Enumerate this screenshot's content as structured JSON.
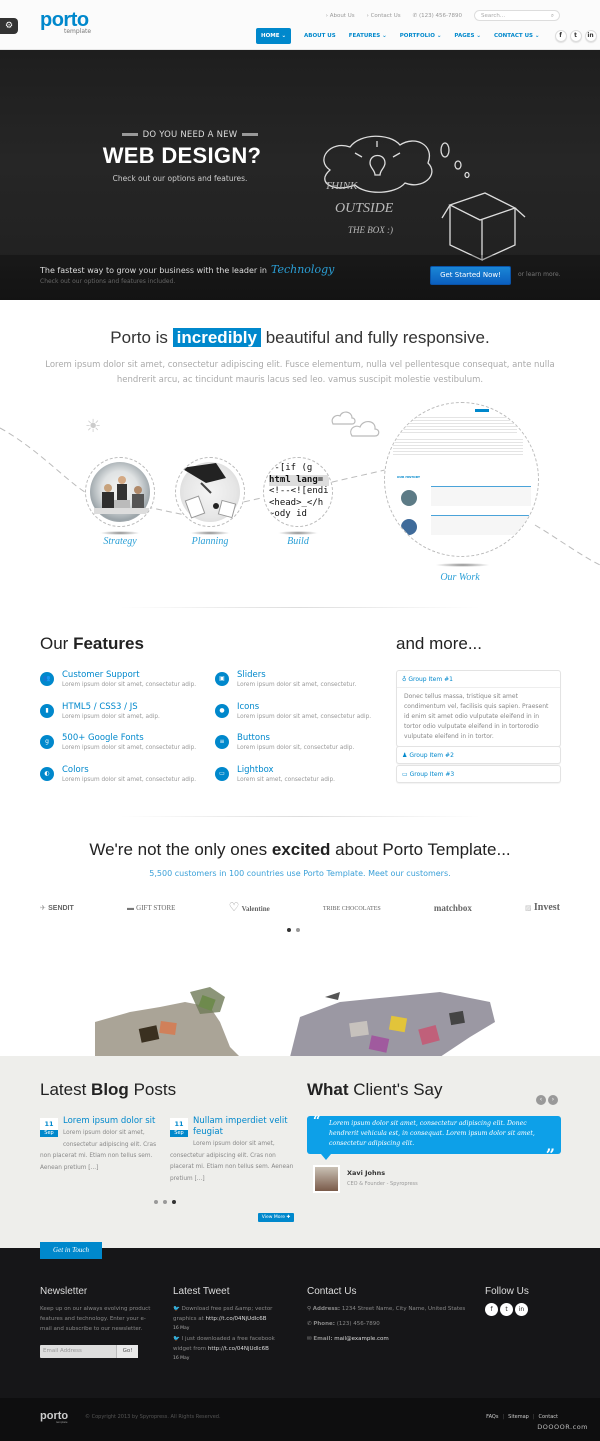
{
  "header": {
    "logo": "porto",
    "logo_sub": "template",
    "config_icon": "gears-icon",
    "top_links": [
      "About Us",
      "Contact Us"
    ],
    "phone": "(123) 456-7890",
    "search_placeholder": "Search...",
    "nav": [
      "HOME",
      "ABOUT US",
      "FEATURES",
      "PORTFOLIO",
      "PAGES",
      "CONTACT US"
    ],
    "social": [
      "f",
      "t",
      "in"
    ]
  },
  "hero": {
    "pre_title": "DO YOU NEED A NEW",
    "title": "WEB DESIGN?",
    "subtitle": "Check out our options and features.",
    "chalk_lines": [
      "THINK",
      "OUTSIDE",
      "THE BOX :)"
    ],
    "strip_text": "The fastest way to grow your business with the leader in",
    "strip_highlight": "Technology",
    "strip_sub": "Check out our options and features included.",
    "cta": "Get Started Now!",
    "learn_more": "or learn more."
  },
  "tagline": {
    "before": "Porto is",
    "highlight": "incredibly",
    "after": "beautiful and fully responsive.",
    "paragraph": "Lorem ipsum dolor sit amet, consectetur adipiscing elit. Fusce elementum, nulla vel pellentesque consequat, ante nulla hendrerit arcu, ac tincidunt mauris lacus sed leo. vamus suscipit molestie vestibulum."
  },
  "process": {
    "steps": [
      "Strategy",
      "Planning",
      "Build",
      "Our Work"
    ],
    "code_lines": [
      "--[if (g",
      "html lang=",
      "<!--<![endi",
      "<head>_</h",
      "~ody id"
    ],
    "our_history": "OUR HISTORY"
  },
  "features": {
    "title_light": "Our",
    "title_bold": "Features",
    "items": [
      {
        "title": "Customer Support",
        "desc": "Lorem ipsum dolor sit amet, consectetur adip.",
        "icon": "users-icon"
      },
      {
        "title": "HTML5 / CSS3 / JS",
        "desc": "Lorem ipsum dolor sit amet, adip.",
        "icon": "file-icon"
      },
      {
        "title": "500+ Google Fonts",
        "desc": "Lorem ipsum dolor sit amet, consectetur adip.",
        "icon": "google-icon"
      },
      {
        "title": "Colors",
        "desc": "Lorem ipsum dolor sit amet, consectetur adip.",
        "icon": "adjust-icon"
      },
      {
        "title": "Sliders",
        "desc": "Lorem ipsum dolor sit amet, consectetur.",
        "icon": "film-icon"
      },
      {
        "title": "Icons",
        "desc": "Lorem ipsum dolor sit amet, consectetur adip.",
        "icon": "user-icon"
      },
      {
        "title": "Buttons",
        "desc": "Lorem ipsum dolor sit, consectetur adip.",
        "icon": "bars-icon"
      },
      {
        "title": "Lightbox",
        "desc": "Lorem sit amet, consectetur adip.",
        "icon": "desktop-icon"
      }
    ]
  },
  "more": {
    "title": "and more...",
    "groups": [
      {
        "label": "Group Item #1",
        "icon": "lightbulb-icon",
        "body": "Donec tellus massa, tristique sit amet condimentum vel, facilisis quis sapien. Praesent id enim sit amet odio vulputate eleifend in in tortor odio vulputate eleifend in in tortorodio vulputate eleifend in in tortor."
      },
      {
        "label": "Group Item #2",
        "icon": "bell-icon"
      },
      {
        "label": "Group Item #3",
        "icon": "laptop-icon"
      }
    ]
  },
  "customers": {
    "title_before": "We're not the only ones",
    "title_bold": "excited",
    "title_after": "about Porto Template...",
    "subtitle": "5,500 customers in 100 countries use Porto Template. Meet our customers.",
    "logos": [
      "SENDIT",
      "GIFT STORE",
      "Valentine",
      "TRIBE CHOCOLATES",
      "matchbox",
      "Invest"
    ],
    "pages": 2,
    "active_page": 1
  },
  "blog": {
    "title_light": "Latest",
    "title_bold": "Blog",
    "title_after": "Posts",
    "posts": [
      {
        "day": "11",
        "month": "Sep",
        "title": "Lorem ipsum dolor sit",
        "first": "Lorem ipsum dolor sit amet,",
        "second": "consectetur adipiscing elit. Cras",
        "rest": "non placerat mi. Etiam non tellus sem. Aenean pretium [...]"
      },
      {
        "day": "11",
        "month": "Sep",
        "title": "Nullam imperdiet velit feugiat",
        "first": "Lorem ipsum dolor sit amet,",
        "second": "",
        "rest": "consectetur adipiscing elit. Cras non placerat mi. Etiam non tellus sem. Aenean pretium [...]"
      }
    ],
    "pages": 3,
    "active_page": 3,
    "view_more": "View More"
  },
  "testimonial": {
    "title_bold": "What",
    "title_light": "Client's Say",
    "quote": "Lorem ipsum dolor sit amet, consectetur adipiscing elit. Donec hendrerit vehicula est, in consequat. Lorem ipsum dolor sit amet, consectetur adipiscing elit.",
    "name": "Xavi Johns",
    "role": "CEO & Founder - Spyropress"
  },
  "footer": {
    "ribbon": "Get in Touch",
    "newsletter": {
      "title": "Newsletter",
      "text": "Keep up on our always evolving product features and technology. Enter your e-mail and subscribe to our newsletter.",
      "placeholder": "Email Address",
      "button": "Go!"
    },
    "tweets": {
      "title": "Latest Tweet",
      "items": [
        {
          "text": "Download free psd &amp; vector graphics at",
          "link": "http://t.co/04NjUdlc6B",
          "date": "16 May"
        },
        {
          "text": "I just downloaded a free facebook widget from",
          "link": "http://t.co/04NjUdlc6B",
          "date": "16 May"
        }
      ]
    },
    "contact": {
      "title": "Contact Us",
      "address_label": "Address:",
      "address": "1234 Street Name, City Name, United States",
      "phone_label": "Phone:",
      "phone": "(123) 456-7890",
      "email_label": "Email:",
      "email": "mail@example.com"
    },
    "follow": {
      "title": "Follow Us",
      "social": [
        "f",
        "t",
        "in"
      ]
    },
    "logo": "porto",
    "logo_sub": "template",
    "copyright": "© Copyright 2013 by Spyropress. All Rights Reserved.",
    "links": [
      "FAQs",
      "Sitemap",
      "Contact"
    ],
    "watermark": "DOOOOR.com"
  }
}
